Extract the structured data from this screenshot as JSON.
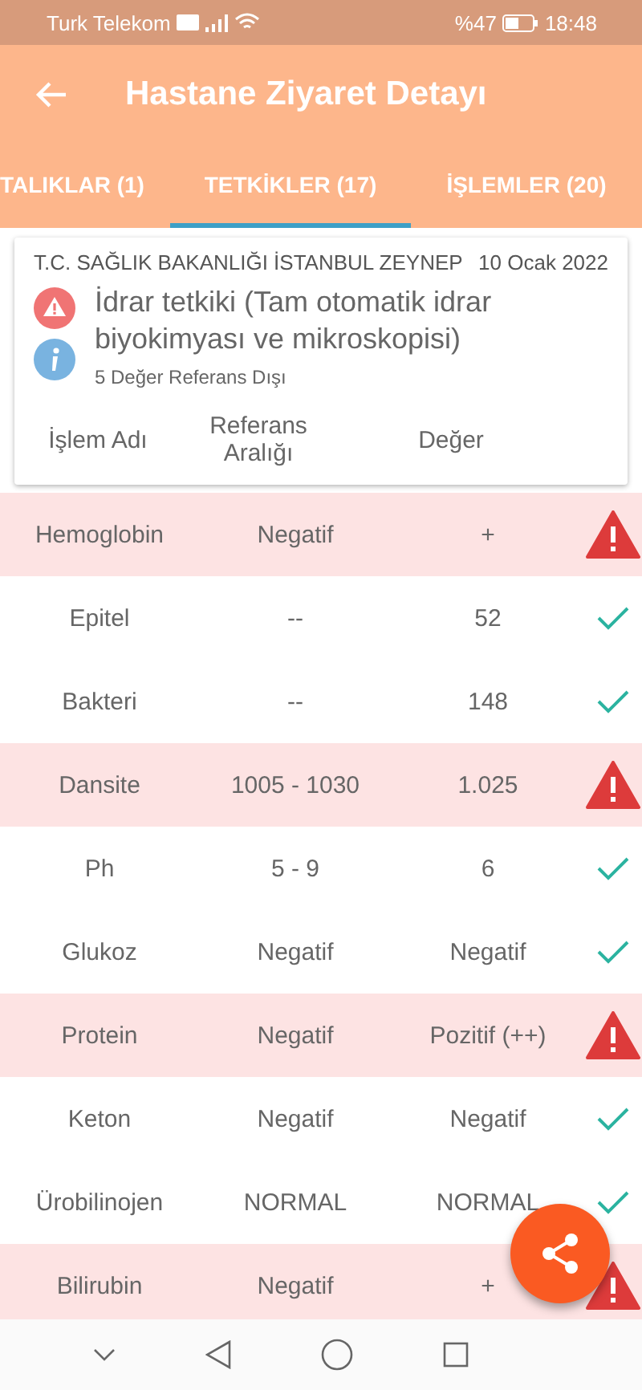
{
  "status_bar": {
    "carrier": "Turk Telekom",
    "battery_text": "%47",
    "time": "18:48"
  },
  "app_bar": {
    "title": "Hastane Ziyaret Detayı"
  },
  "tabs": [
    {
      "label": "TALIKLAR (1)",
      "selected": false
    },
    {
      "label": "TETKİKLER (17)",
      "selected": true
    },
    {
      "label": "İŞLEMLER (20)",
      "selected": false
    }
  ],
  "card": {
    "hospital": "T.C. SAĞLIK BAKANLIĞI İSTANBUL ZEYNEP",
    "date": "10 Ocak 2022",
    "test_name": "İdrar tetkiki (Tam otomatik idrar biyokimyası ve mikroskopisi)",
    "summary": "5 Değer Referans Dışı",
    "columns": [
      "İşlem Adı",
      "Referans Aralığı",
      "Değer"
    ]
  },
  "rows": [
    {
      "name": "Hemoglobin",
      "reference": "Negatif",
      "value": "+",
      "abnormal": true
    },
    {
      "name": "Epitel",
      "reference": "--",
      "value": "52",
      "abnormal": false
    },
    {
      "name": "Bakteri",
      "reference": "--",
      "value": "148",
      "abnormal": false
    },
    {
      "name": "Dansite",
      "reference": "1005 - 1030",
      "value": "1.025",
      "abnormal": true
    },
    {
      "name": "Ph",
      "reference": "5 - 9",
      "value": "6",
      "abnormal": false
    },
    {
      "name": "Glukoz",
      "reference": "Negatif",
      "value": "Negatif",
      "abnormal": false
    },
    {
      "name": "Protein",
      "reference": "Negatif",
      "value": "Pozitif (++)",
      "abnormal": true
    },
    {
      "name": "Keton",
      "reference": "Negatif",
      "value": "Negatif",
      "abnormal": false
    },
    {
      "name": "Ürobilinojen",
      "reference": "NORMAL",
      "value": "NORMAL",
      "abnormal": false
    },
    {
      "name": "Bilirubin",
      "reference": "Negatif",
      "value": "+",
      "abnormal": true
    }
  ]
}
